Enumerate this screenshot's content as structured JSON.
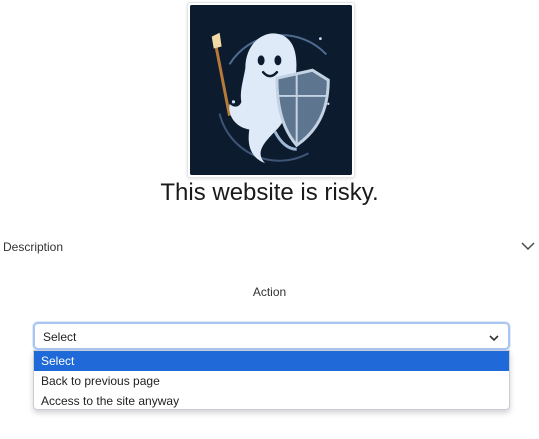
{
  "logo": {
    "icon": "ghost-with-shield-icon"
  },
  "headline": "This website is risky.",
  "description": {
    "label": "Description",
    "icon": "chevron-down-icon"
  },
  "action": {
    "label": "Action",
    "select": {
      "value": "Select",
      "icon": "chevron-down-icon",
      "options": [
        {
          "label": "Select",
          "selected": true
        },
        {
          "label": "Back to previous page",
          "selected": false
        },
        {
          "label": "Access to the site anyway",
          "selected": false
        }
      ]
    }
  },
  "colors": {
    "selected_option": "#1f6ad8",
    "logo_background": "#0d1b2e",
    "focus_border": "#a9c6f2"
  }
}
